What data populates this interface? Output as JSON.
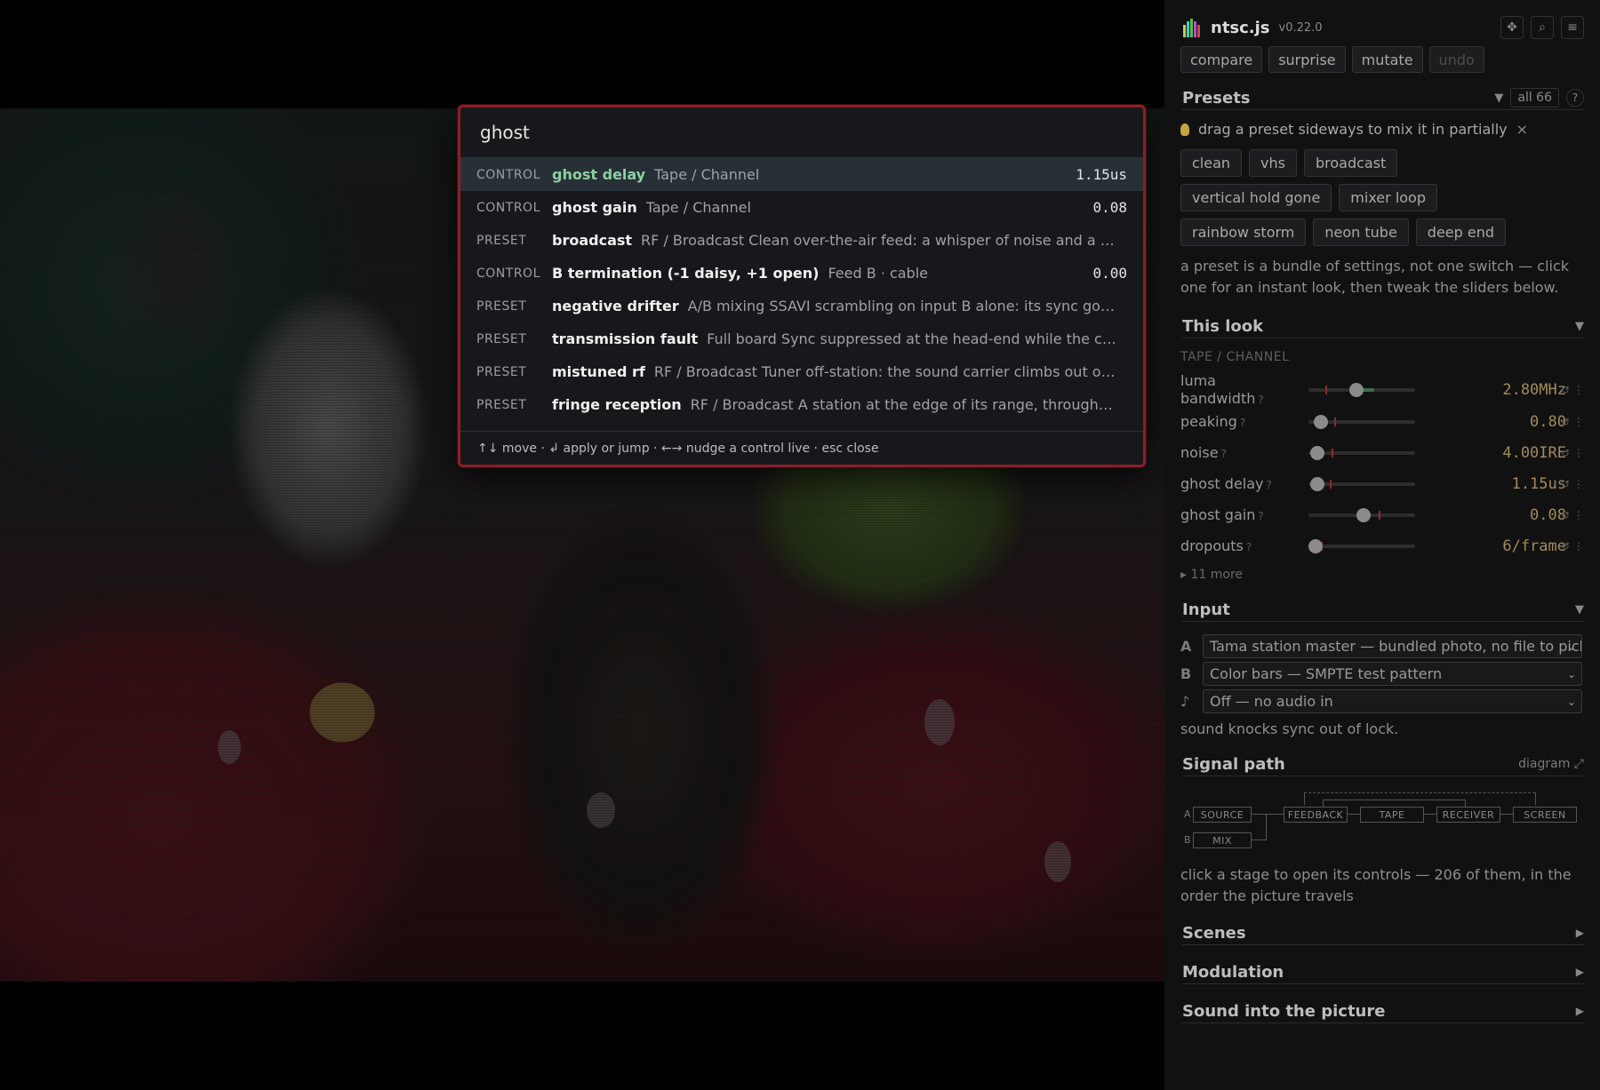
{
  "palette": {
    "query": "ghost",
    "results": [
      {
        "kind": "CONTROL",
        "name": "ghost delay",
        "desc": "Tape / Channel",
        "value": "1.15us"
      },
      {
        "kind": "CONTROL",
        "name": "ghost gain",
        "desc": "Tape / Channel",
        "value": "0.08"
      },
      {
        "kind": "PRESET",
        "name": "broadcast",
        "desc": "RF / Broadcast Clean over-the-air feed: a whisper of noise and a sof…",
        "value": ""
      },
      {
        "kind": "CONTROL",
        "name": "B termination (-1 daisy, +1 open)",
        "desc": "Feed B · cable",
        "value": "0.00"
      },
      {
        "kind": "PRESET",
        "name": "negative drifter",
        "desc": "A/B mixing SSAVI scrambling on input B alone: its sync goes t…",
        "value": ""
      },
      {
        "kind": "PRESET",
        "name": "transmission fault",
        "desc": "Full board Sync suppressed at the head-end while the colo…",
        "value": ""
      },
      {
        "kind": "PRESET",
        "name": "mistuned rf",
        "desc": "RF / Broadcast Tuner off-station: the sound carrier climbs out of i…",
        "value": ""
      },
      {
        "kind": "PRESET",
        "name": "fringe reception",
        "desc": "RF / Broadcast A station at the edge of its range, through th…",
        "value": ""
      }
    ],
    "footer": "↑↓ move · ↲ apply or jump · ←→ nudge a control live · esc close"
  },
  "app": {
    "title": "ntsc.js",
    "version": "v0.22.0"
  },
  "toolbar": {
    "compare": "compare",
    "surprise": "surprise",
    "mutate": "mutate",
    "undo": "undo"
  },
  "presets": {
    "title": "Presets",
    "filter": "all 66",
    "help": "?",
    "tip": "drag a preset sideways to mix it in partially",
    "tip_close": "×",
    "items": [
      "clean",
      "vhs",
      "broadcast",
      "vertical hold gone",
      "mixer loop",
      "rainbow storm",
      "neon tube",
      "deep end"
    ],
    "description": "a preset is a bundle of settings, not one switch — click one for an instant look, then tweak the sliders below."
  },
  "look": {
    "title": "This look",
    "group": "TAPE / CHANNEL",
    "sliders": [
      {
        "label": "luma bandwidth",
        "value": "2.80MHz",
        "pos": 0.45,
        "fill_from": 0.45,
        "fill_to": 0.62,
        "tick": 0.16
      },
      {
        "label": "peaking",
        "value": "0.80",
        "pos": 0.12,
        "tick": 0.24
      },
      {
        "label": "noise",
        "value": "4.00IRE",
        "pos": 0.08,
        "tick": 0.22
      },
      {
        "label": "ghost delay",
        "value": "1.15us",
        "pos": 0.08,
        "tick": 0.2
      },
      {
        "label": "ghost gain",
        "value": "0.08",
        "pos": 0.52,
        "tick": 0.66
      },
      {
        "label": "dropouts",
        "value": "6/frame",
        "pos": 0.07,
        "tick": 0.12
      }
    ],
    "more": "▸ 11 more"
  },
  "input": {
    "title": "Input",
    "rows": [
      {
        "key": "A",
        "value": "Tama station master — bundled photo, no file to pick"
      },
      {
        "key": "B",
        "value": "Color bars — SMPTE test pattern"
      },
      {
        "key": "♪",
        "value": "Off — no audio in"
      }
    ],
    "note": "sound knocks sync out of lock."
  },
  "signal": {
    "title": "Signal path",
    "link": "diagram ⤢",
    "stages": {
      "a": "A",
      "b": "B",
      "source": "SOURCE",
      "mix": "MIX",
      "feedback": "FEEDBACK",
      "tape": "TAPE",
      "receiver": "RECEIVER",
      "screen": "SCREEN"
    },
    "note": "click a stage to open its controls — 206 of them, in the order the picture travels"
  },
  "sections": {
    "scenes": "Scenes",
    "modulation": "Modulation",
    "sound": "Sound into the picture"
  }
}
